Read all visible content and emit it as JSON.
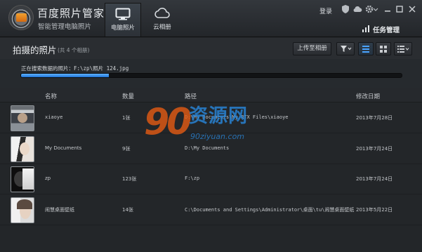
{
  "app": {
    "title": "百度照片管家",
    "subtitle": "智能管理电脑照片",
    "login": "登录",
    "task_manager": "任务管理"
  },
  "nav": {
    "tabs": [
      {
        "label": "电脑照片",
        "icon": "monitor-icon",
        "active": true
      },
      {
        "label": "云相册",
        "icon": "cloud-icon",
        "active": false
      }
    ]
  },
  "window_icons": [
    "shield-icon",
    "cloud-icon",
    "gear-icon",
    "minimize-icon",
    "maximize-icon",
    "close-icon"
  ],
  "section": {
    "title": "拍摄的照片",
    "count": "(共 4 个相册)",
    "upload_label": "上传至相册"
  },
  "progress": {
    "text": "正在搜索数据的照片：F:\\zp\\照片 124.jpg",
    "value": 0.23,
    "color": "#3a8ff0"
  },
  "table": {
    "columns": [
      "名称",
      "数量",
      "路径",
      "修改日期"
    ],
    "rows": [
      {
        "name": "xiaoye",
        "count": "1张",
        "path": "D:\\My Documents\\My RTX Files\\xiaoye",
        "date": "2013年7月28日"
      },
      {
        "name": "My Documents",
        "count": "9张",
        "path": "D:\\My Documents",
        "date": "2013年7月24日"
      },
      {
        "name": "zp",
        "count": "123张",
        "path": "F:\\zp",
        "date": "2013年7月24日"
      },
      {
        "name": "闹慧桌面壁纸",
        "count": "14张",
        "path": "C:\\Documents and Settings\\Administrator\\桌面\\tu\\闹慧桌面壁纸",
        "date": "2013年5月22日"
      }
    ]
  },
  "watermark": {
    "number": "90",
    "text": "资源网",
    "url": "90ziyuan.com"
  }
}
